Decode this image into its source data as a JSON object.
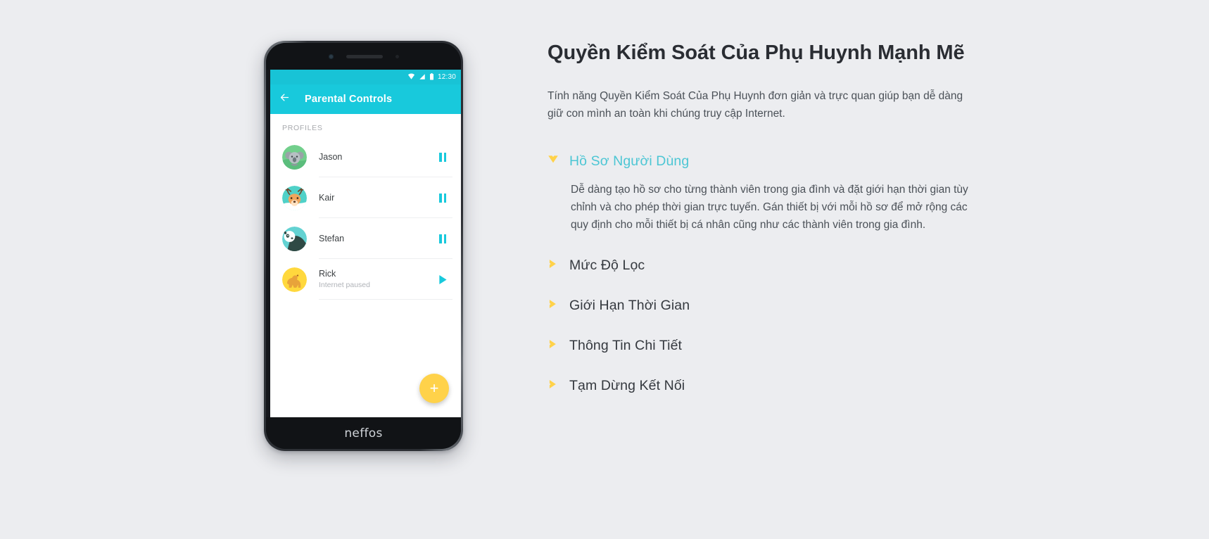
{
  "theme": {
    "page_bg": "#ecedf0",
    "accent_teal": "#18c9dc",
    "accent_yellow": "#ffd24a",
    "heading_color": "#2a2d33",
    "open_title_color": "#4cc6d4"
  },
  "phone": {
    "brand_label": "neffos",
    "status_bar": {
      "time": "12:30",
      "icons": [
        "wifi-icon",
        "signal-icon",
        "battery-icon"
      ]
    },
    "app_bar": {
      "back_icon": "back-arrow-icon",
      "title": "Parental Controls"
    },
    "section_label": "PROFILES",
    "profiles": [
      {
        "name": "Jason",
        "subtitle": "",
        "avatar": "koala-avatar",
        "avatar_bg": "#6fcf97",
        "action_icon": "pause-icon"
      },
      {
        "name": "Kair",
        "subtitle": "",
        "avatar": "deer-avatar",
        "avatar_bg": "#4fd1c8",
        "action_icon": "pause-icon"
      },
      {
        "name": "Stefan",
        "subtitle": "",
        "avatar": "panda-avatar",
        "avatar_bg": "#63d2d2",
        "action_icon": "pause-icon"
      },
      {
        "name": "Rick",
        "subtitle": "Internet paused",
        "avatar": "camel-avatar",
        "avatar_bg": "#ffd83d",
        "action_icon": "play-icon"
      }
    ],
    "fab": {
      "label": "+",
      "name": "add-profile-fab"
    }
  },
  "content": {
    "headline": "Quyền Kiểm Soát Của Phụ Huynh Mạnh Mẽ",
    "lede": "Tính năng Quyền Kiểm Soát Của Phụ Huynh đơn giản và trực quan giúp bạn dễ dàng giữ con mình an toàn khi chúng truy cập Internet.",
    "accordion": [
      {
        "title": "Hồ Sơ Người Dùng",
        "open": true,
        "icon": "chevron-down-icon",
        "body": "Dễ dàng tạo hồ sơ cho từng thành viên trong gia đình và đặt giới hạn thời gian tùy chỉnh và cho phép thời gian trực tuyến. Gán thiết bị với mỗi hồ sơ để mở rộng các quy định cho mỗi thiết bị cá nhân cũng như các thành viên trong gia đình."
      },
      {
        "title": "Mức Độ Lọc",
        "open": false,
        "icon": "chevron-right-icon",
        "body": ""
      },
      {
        "title": "Giới Hạn Thời Gian",
        "open": false,
        "icon": "chevron-right-icon",
        "body": ""
      },
      {
        "title": "Thông Tin Chi Tiết",
        "open": false,
        "icon": "chevron-right-icon",
        "body": ""
      },
      {
        "title": "Tạm Dừng Kết Nối",
        "open": false,
        "icon": "chevron-right-icon",
        "body": ""
      }
    ]
  }
}
